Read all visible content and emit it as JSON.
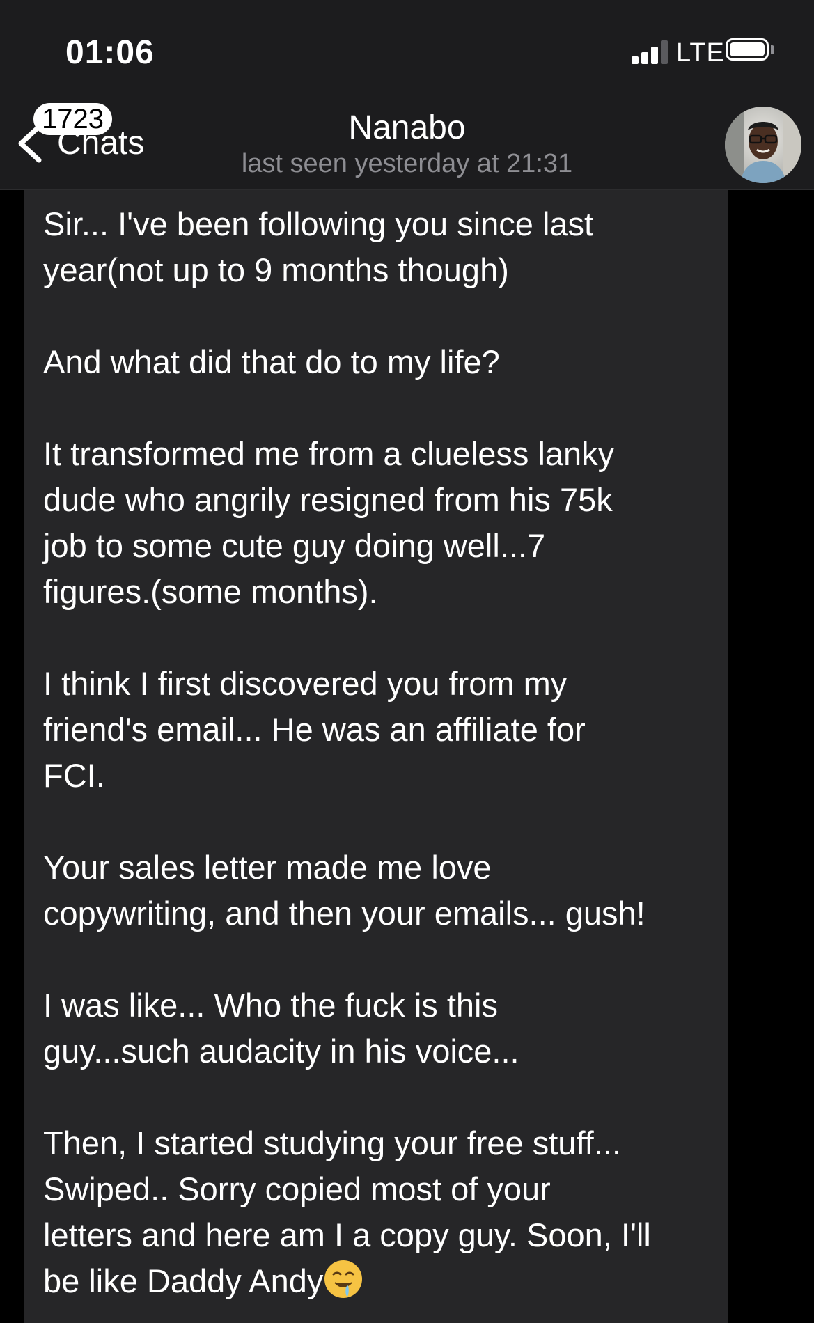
{
  "status_bar": {
    "time": "01:06",
    "network": "LTE",
    "signal_bars_active": 3,
    "signal_bars_total": 4,
    "battery_level": 1.0
  },
  "header": {
    "back_label": "Chats",
    "unread_count": "1723",
    "contact_name": "Nanabo",
    "last_seen": "last seen yesterday at 21:31"
  },
  "icons": {
    "back": "chevron-left-icon",
    "signal": "cellular-signal-icon",
    "battery": "battery-icon",
    "emoji": "drooling-face-emoji"
  },
  "colors": {
    "header_bg": "#1c1c1e",
    "bubble_bg": "#262628",
    "secondary_text": "#8e8e93",
    "text": "#ffffff"
  },
  "message": {
    "paragraphs": [
      "Sir... I've been following you since last\nyear(not up to 9 months though)",
      "And what did that do to my life?",
      "It transformed me from a clueless lanky\ndude who angrily resigned from his 75k\njob to some cute guy doing well...7\nfigures.(some months).",
      "I think I first discovered you from my\nfriend's email... He was an affiliate for\nFCI.",
      "Your sales letter made me love\ncopywriting, and then your emails... gush!",
      "I was like... Who the fuck is this\nguy...such audacity in his voice...",
      "Then, I started studying your free stuff...\nSwiped.. Sorry copied most of your\nletters and here am I a copy guy. Soon, I'll\nbe like Daddy Andy"
    ]
  }
}
